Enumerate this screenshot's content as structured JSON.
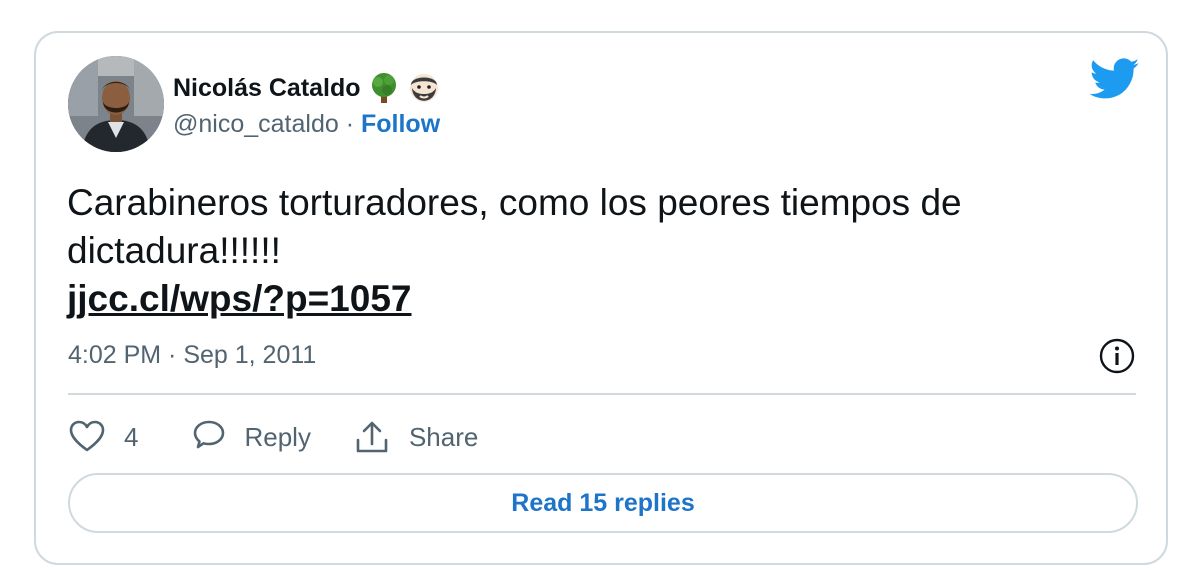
{
  "tweet": {
    "author": {
      "name": "Nicolás Cataldo",
      "emojis": [
        "tree-emoji",
        "bearded-face-emoji"
      ],
      "handle": "@nico_cataldo",
      "separator": "·",
      "follow_label": "Follow"
    },
    "text": "Carabineros torturadores, como los peores tiempos de dictadura!!!!!!",
    "link": "jjcc.cl/wps/?p=1057",
    "timestamp": "4:02 PM · Sep 1, 2011",
    "likes": "4",
    "reply_label": "Reply",
    "share_label": "Share",
    "read_replies_label": "Read 15 replies"
  },
  "colors": {
    "accent": "#1d74c9",
    "twitter_blue": "#1d9bf0",
    "border": "#cfd9de",
    "secondary_text": "#536471"
  }
}
